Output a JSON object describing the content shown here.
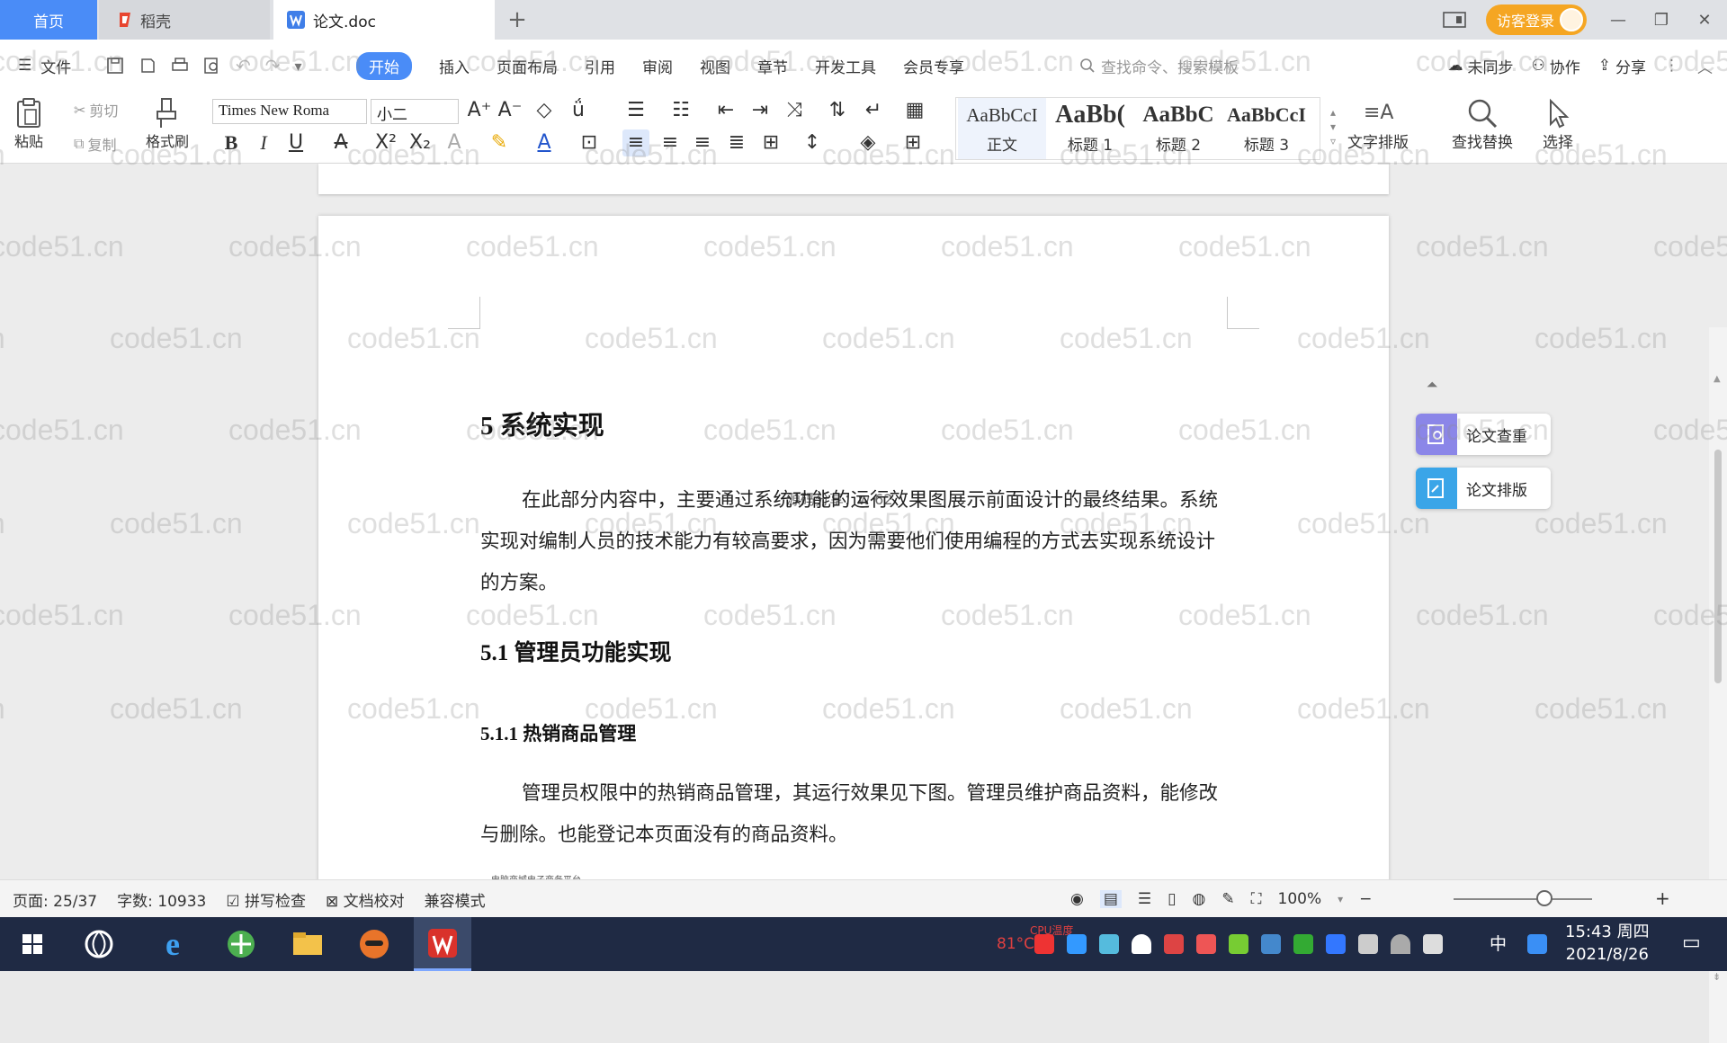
{
  "title_bar": {
    "home_tab": "首页",
    "daoke_tab": "稻壳",
    "doc_tab": "论文.doc",
    "new_tab": "+",
    "login_button": "访客登录"
  },
  "menu": {
    "file": "文件",
    "tabs": [
      "开始",
      "插入",
      "页面布局",
      "引用",
      "审阅",
      "视图",
      "章节",
      "开发工具",
      "会员专享"
    ],
    "search_placeholder": "查找命令、搜索模板",
    "sync": "未同步",
    "collab": "协作",
    "share": "分享"
  },
  "ribbon": {
    "paste": "粘贴",
    "cut": "剪切",
    "copy": "复制",
    "format_painter": "格式刷",
    "font_name": "Times New Roma",
    "font_size": "小二",
    "styles": [
      {
        "preview": "AaBbCcI",
        "label": "正文"
      },
      {
        "preview": "AaBb(",
        "label": "标题 1"
      },
      {
        "preview": "AaBbC",
        "label": "标题 2"
      },
      {
        "preview": "AaBbCcI",
        "label": "标题 3"
      }
    ],
    "text_layout": "文字排版",
    "find_replace": "查找替换",
    "select": "选择"
  },
  "document": {
    "heading1": "5  系统实现",
    "para1": "在此部分内容中，主要通过系统功能的运行效果图展示前面设计的最终结果。系统实现对编制人员的技术能力有较高要求，因为需要他们使用编程的方式去实现系统设计的方案。",
    "ghost_text": "源码分享：w 62",
    "heading2": "5.1  管理员功能实现",
    "heading3": "5.1.1  热销商品管理",
    "para2": "管理员权限中的热销商品管理，其运行效果见下图。管理员维护商品资料，能修改与删除。也能登记本页面没有的商品资料。",
    "figure_caption": "电脑商城电子商务平台"
  },
  "side_panel": {
    "check": "论文查重",
    "layout": "论文排版"
  },
  "status_bar": {
    "page": "页面: 25/37",
    "words": "字数: 10933",
    "spell_check": "拼写检查",
    "proof": "文档校对",
    "compat": "兼容模式",
    "zoom": "100%"
  },
  "taskbar": {
    "temp": "81°C",
    "cpu_label": "CPU温度",
    "ime": "中",
    "time": "15:43 周四",
    "date": "2021/8/26"
  },
  "watermark": "code51.cn",
  "colors": {
    "accent": "#4a8cf7",
    "login": "#f5a623",
    "taskbar": "#1f2a44"
  }
}
